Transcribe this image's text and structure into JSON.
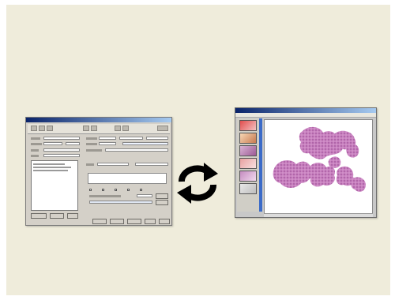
{
  "screen": {
    "background": "#efecdb",
    "scene": "workflow-illustration"
  },
  "form_window": {
    "title_text": "",
    "icons": [
      "app-icon",
      "toolbar-button-icons"
    ],
    "accent": "#0a246a"
  },
  "sync_arrows": {
    "icon": "refresh-cycle-icon",
    "color": "#000000"
  },
  "viewer_window": {
    "title_text": "",
    "tissue_color": "#c07ab8",
    "accent": "#3b6bc8"
  }
}
